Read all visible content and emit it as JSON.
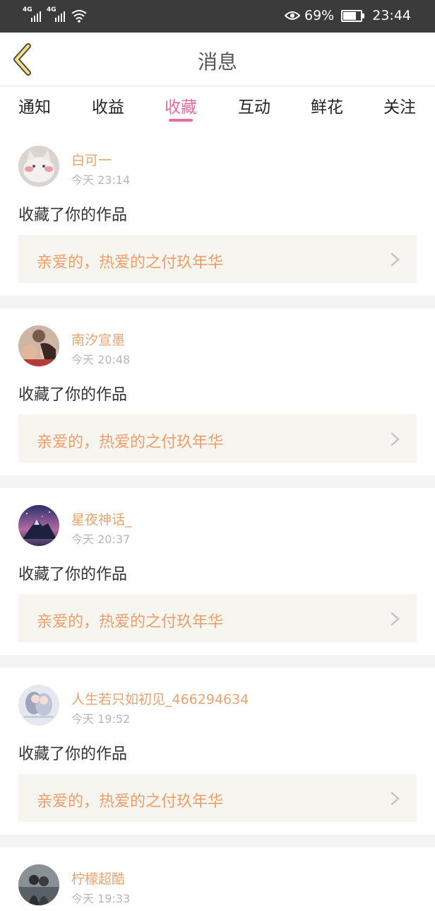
{
  "status_bar": {
    "network_1": "4G",
    "network_2": "4G",
    "battery_percent": "69%",
    "battery_level": 0.69,
    "time": "23:44",
    "icons": [
      "signal-icon",
      "signal-icon",
      "wifi-icon",
      "eye-icon",
      "battery-icon"
    ]
  },
  "header": {
    "title": "消息",
    "back_icon": "chevron-left-icon"
  },
  "tabs": [
    {
      "label": "通知",
      "active": false
    },
    {
      "label": "收益",
      "active": false
    },
    {
      "label": "收藏",
      "active": true
    },
    {
      "label": "互动",
      "active": false
    },
    {
      "label": "鲜花",
      "active": false
    },
    {
      "label": "关注",
      "active": false
    }
  ],
  "colors": {
    "accent": "#e56da0",
    "username": "#e9a36f",
    "work_title": "#ef9d6a",
    "status_bar": "#3b3b3b"
  },
  "messages": [
    {
      "username": "白可一",
      "time": "今天 23:14",
      "action": "收藏了你的作品",
      "work": "亲爱的，热爱的之付玖年华"
    },
    {
      "username": "南汐宣墨",
      "time": "今天 20:48",
      "action": "收藏了你的作品",
      "work": "亲爱的，热爱的之付玖年华"
    },
    {
      "username": "星夜神话_",
      "time": "今天 20:37",
      "action": "收藏了你的作品",
      "work": "亲爱的，热爱的之付玖年华"
    },
    {
      "username": "人生若只如初见_466294634",
      "time": "今天 19:52",
      "action": "收藏了你的作品",
      "work": "亲爱的，热爱的之付玖年华"
    },
    {
      "username": "柠檬超酷",
      "time": "今天 19:33",
      "action": "",
      "work": ""
    }
  ]
}
